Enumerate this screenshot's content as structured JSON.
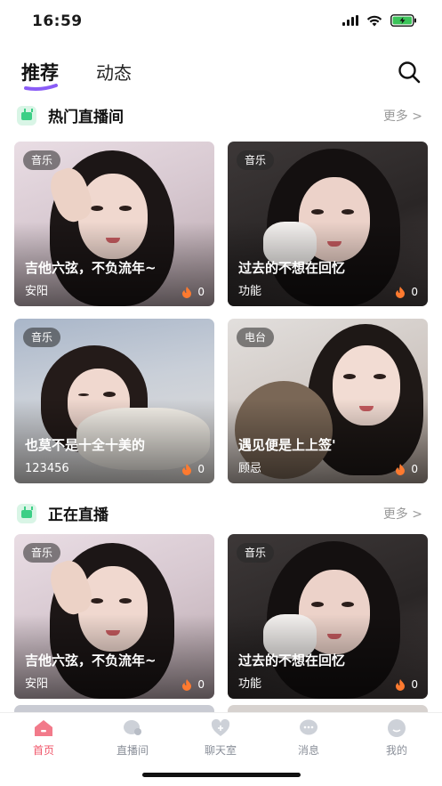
{
  "status_bar": {
    "time": "16:59"
  },
  "top_tabs": [
    {
      "label": "推荐",
      "active": true
    },
    {
      "label": "动态",
      "active": false
    }
  ],
  "sections": [
    {
      "title": "热门直播间",
      "more": "更多 >",
      "cards": [
        {
          "tag": "音乐",
          "title": "吉他六弦，不负流年~",
          "subtitle": "安阳",
          "heat": "0"
        },
        {
          "tag": "音乐",
          "title": "过去的不想在回忆",
          "subtitle": "功能",
          "heat": "0"
        },
        {
          "tag": "音乐",
          "title": "也莫不是十全十美的",
          "subtitle": "123456",
          "heat": "0"
        },
        {
          "tag": "电台",
          "title": "遇见便是上上签'",
          "subtitle": "顾忌",
          "heat": "0"
        }
      ]
    },
    {
      "title": "正在直播",
      "more": "更多 >",
      "cards": [
        {
          "tag": "音乐",
          "title": "吉他六弦，不负流年~",
          "subtitle": "安阳",
          "heat": "0"
        },
        {
          "tag": "音乐",
          "title": "过去的不想在回忆",
          "subtitle": "功能",
          "heat": "0"
        }
      ]
    }
  ],
  "bottom_nav": [
    {
      "label": "首页",
      "icon": "home-icon",
      "active": true
    },
    {
      "label": "直播间",
      "icon": "live-room-icon",
      "active": false
    },
    {
      "label": "聊天室",
      "icon": "chatroom-icon",
      "active": false
    },
    {
      "label": "消息",
      "icon": "message-icon",
      "active": false
    },
    {
      "label": "我的",
      "icon": "profile-icon",
      "active": false
    }
  ],
  "colors": {
    "accent": "#8a5cf6",
    "active_nav": "#f0566a",
    "section_icon": "#3ccf86",
    "heat_icon": "#ff7a2f"
  }
}
